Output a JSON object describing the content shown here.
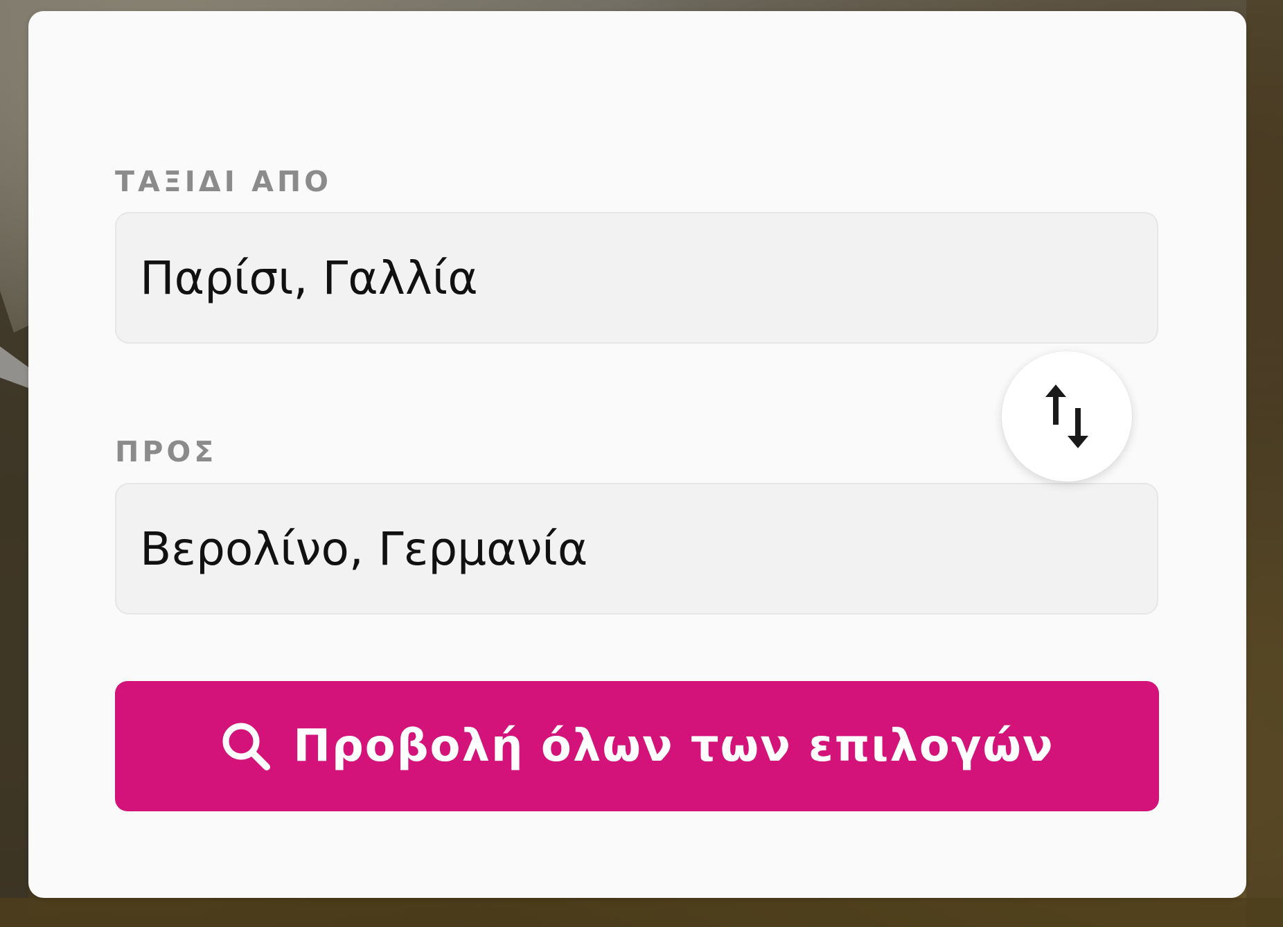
{
  "form": {
    "origin": {
      "label": "ΤΑΞΙΔΙ ΑΠΟ",
      "value": "Παρίσι, Γαλλία"
    },
    "destination": {
      "label": "ΠΡΟΣ",
      "value": "Βερολίνο, Γερμανία"
    },
    "swap_icon": "swap-vertical-arrows-icon",
    "search_button": {
      "label": "Προβολή όλων των επιλογών",
      "icon": "search-icon"
    }
  },
  "colors": {
    "accent": "#d4137a",
    "card_background": "#fafafa",
    "field_background": "#f2f2f2",
    "label_text": "#8b8b8b",
    "value_text": "#111111"
  }
}
